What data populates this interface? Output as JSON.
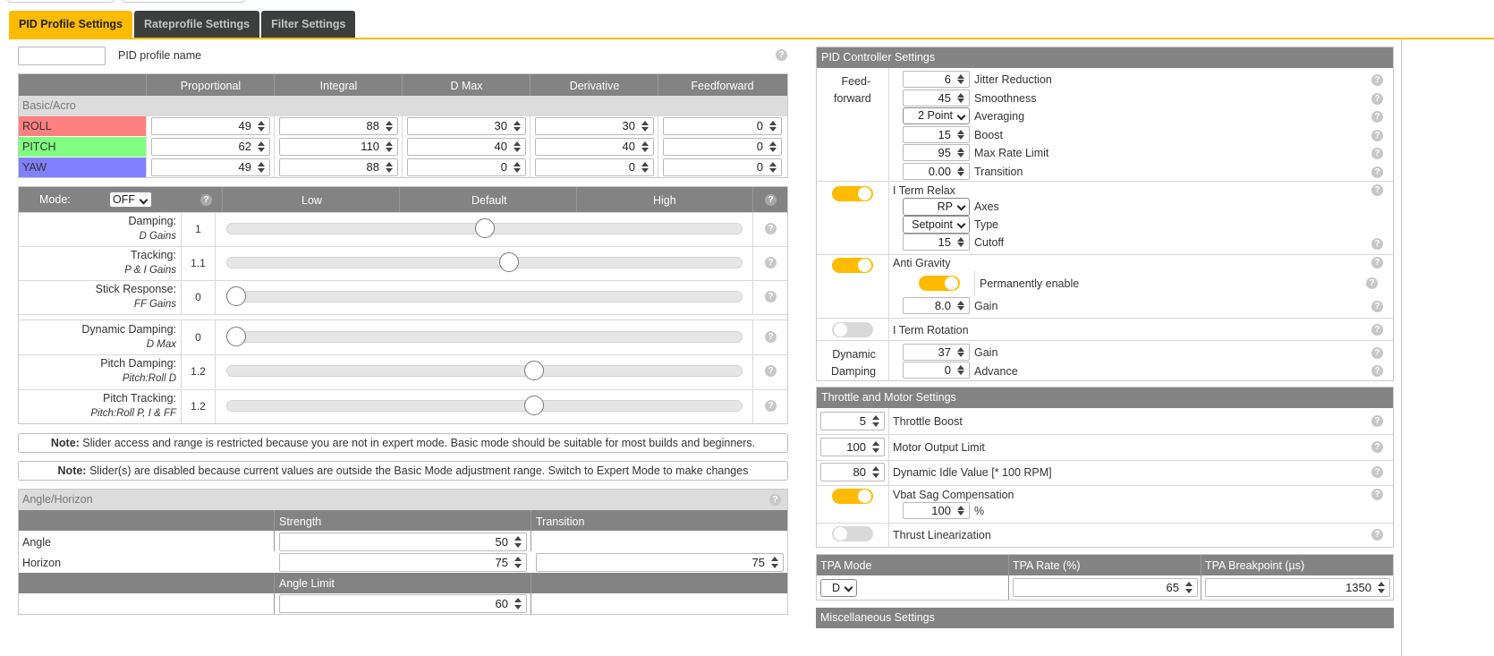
{
  "tabs": [
    {
      "label": "PID Profile Settings"
    },
    {
      "label": "Rateprofile Settings"
    },
    {
      "label": "Filter Settings"
    }
  ],
  "profile": {
    "name_value": "",
    "label": "PID profile name"
  },
  "pid_table": {
    "columns": [
      "Proportional",
      "Integral",
      "D Max",
      "Derivative",
      "Feedforward"
    ],
    "section": "Basic/Acro",
    "rows": [
      {
        "axis": "ROLL",
        "color": "#ff8080",
        "values": [
          "49",
          "88",
          "30",
          "30",
          "0"
        ]
      },
      {
        "axis": "PITCH",
        "color": "#80ff80",
        "values": [
          "62",
          "110",
          "40",
          "40",
          "0"
        ]
      },
      {
        "axis": "YAW",
        "color": "#8080ff",
        "values": [
          "49",
          "88",
          "0",
          "0",
          "0"
        ]
      }
    ]
  },
  "sliders": {
    "mode_label": "Mode:",
    "mode_value": "OFF",
    "col_low": "Low",
    "col_default": "Default",
    "col_high": "High",
    "rows": [
      {
        "label": "Damping:",
        "sub": "D Gains",
        "value": "1",
        "pos": 0.5
      },
      {
        "label": "Tracking:",
        "sub": "P & I Gains",
        "value": "1.1",
        "pos": 0.55
      },
      {
        "label": "Stick Response:",
        "sub": "FF Gains",
        "value": "0",
        "pos": 0.0
      },
      {
        "label": "Dynamic Damping:",
        "sub": "D Max",
        "value": "0",
        "pos": 0.0
      },
      {
        "label": "Pitch Damping:",
        "sub": "Pitch:Roll D",
        "value": "1.2",
        "pos": 0.6
      },
      {
        "label": "Pitch Tracking:",
        "sub": "Pitch:Roll P, I & FF",
        "value": "1.2",
        "pos": 0.6
      }
    ]
  },
  "notes": [
    {
      "bold": "Note:",
      "text": " Slider access and range is restricted because you are not in expert mode. Basic mode should be suitable for most builds and beginners."
    },
    {
      "bold": "Note:",
      "text": " Slider(s) are disabled because current values are outside the Basic Mode adjustment range. Switch to Expert Mode to make changes"
    }
  ],
  "angle": {
    "title": "Angle/Horizon",
    "strength": "Strength",
    "transition": "Transition",
    "angle_label": "Angle",
    "horizon_label": "Horizon",
    "angle_strength": "50",
    "horizon_strength": "75",
    "horizon_transition": "75",
    "angle_limit_label": "Angle Limit",
    "angle_limit": "60"
  },
  "pid_controller": {
    "title": "PID Controller Settings",
    "ff_label1": "Feed-",
    "ff_label2": "forward",
    "ff": [
      {
        "value": "6",
        "label": "Jitter Reduction"
      },
      {
        "value": "45",
        "label": "Smoothness"
      },
      {
        "value": "2 Point",
        "label": "Averaging",
        "select": true
      },
      {
        "value": "15",
        "label": "Boost"
      },
      {
        "value": "95",
        "label": "Max Rate Limit"
      },
      {
        "value": "0.00",
        "label": "Transition"
      }
    ],
    "iterm_relax": {
      "label": "I Term Relax",
      "on": true,
      "axes_value": "RP",
      "axes_label": "Axes",
      "type_value": "Setpoint",
      "type_label": "Type",
      "cutoff_value": "15",
      "cutoff_label": "Cutoff"
    },
    "anti_gravity": {
      "label": "Anti Gravity",
      "on": true,
      "perm_label": "Permanently enable",
      "perm_on": true,
      "gain_value": "8.0",
      "gain_label": "Gain"
    },
    "iterm_rotation": {
      "label": "I Term Rotation",
      "on": false
    },
    "dyn_damping": {
      "label1": "Dynamic",
      "label2": "Damping",
      "gain_value": "37",
      "gain_label": "Gain",
      "adv_value": "0",
      "adv_label": "Advance"
    }
  },
  "throttle": {
    "title": "Throttle and Motor Settings",
    "rows": [
      {
        "value": "5",
        "label": "Throttle Boost"
      },
      {
        "value": "100",
        "label": "Motor Output Limit"
      },
      {
        "value": "80",
        "label": "Dynamic Idle Value [* 100 RPM]"
      }
    ],
    "vbat_label": "Vbat Sag Compensation",
    "vbat_on": true,
    "vbat_value": "100",
    "vbat_unit": "%",
    "thrust_label": "Thrust Linearization",
    "thrust_on": false
  },
  "tpa": {
    "mode_label": "TPA Mode",
    "rate_label": "TPA Rate (%)",
    "bp_label": "TPA Breakpoint (µs)",
    "mode_value": "D",
    "rate_value": "65",
    "bp_value": "1350"
  },
  "misc": {
    "title": "Miscellaneous Settings"
  }
}
